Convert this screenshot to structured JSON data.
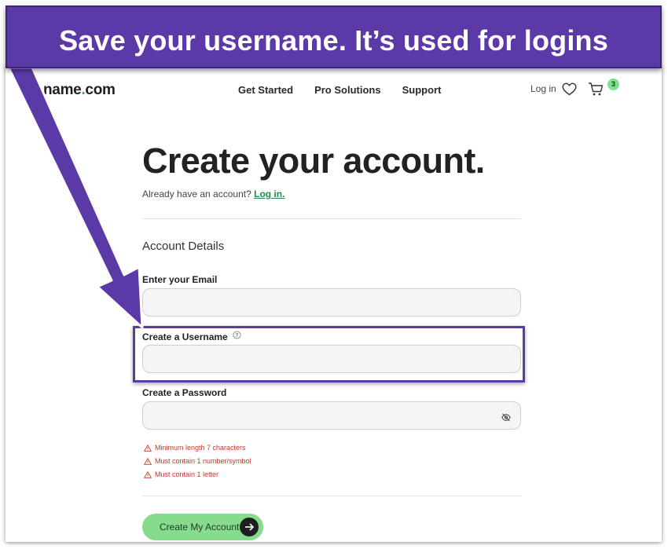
{
  "banner": {
    "text": "Save your username. It’s used for logins",
    "color": "#5b3aa8"
  },
  "header": {
    "logo_prefix": "name",
    "logo_dot": ".",
    "logo_suffix": "com",
    "nav": [
      "Get Started",
      "Pro Solutions",
      "Support"
    ],
    "login": "Log in",
    "cart_count": "3",
    "icons": [
      "heart-icon",
      "cart-icon"
    ]
  },
  "form": {
    "title": "Create your account.",
    "already_text": "Already have an account?",
    "login_link": "Log in.",
    "section_title": "Account Details",
    "email_label": "Enter your Email",
    "email_value": "",
    "username_label": "Create a Username",
    "username_value": "",
    "password_label": "Create a Password",
    "password_value": "",
    "password_rules": [
      "Minimum length 7 characters",
      "Must contain 1 number/symbol",
      "Must contain 1 letter"
    ],
    "submit_label": "Create My Account"
  },
  "colors": {
    "accent": "#5b3aa8",
    "brand_green": "#28b563",
    "cta_green": "#86dc8c",
    "error_red": "#c0392b"
  }
}
